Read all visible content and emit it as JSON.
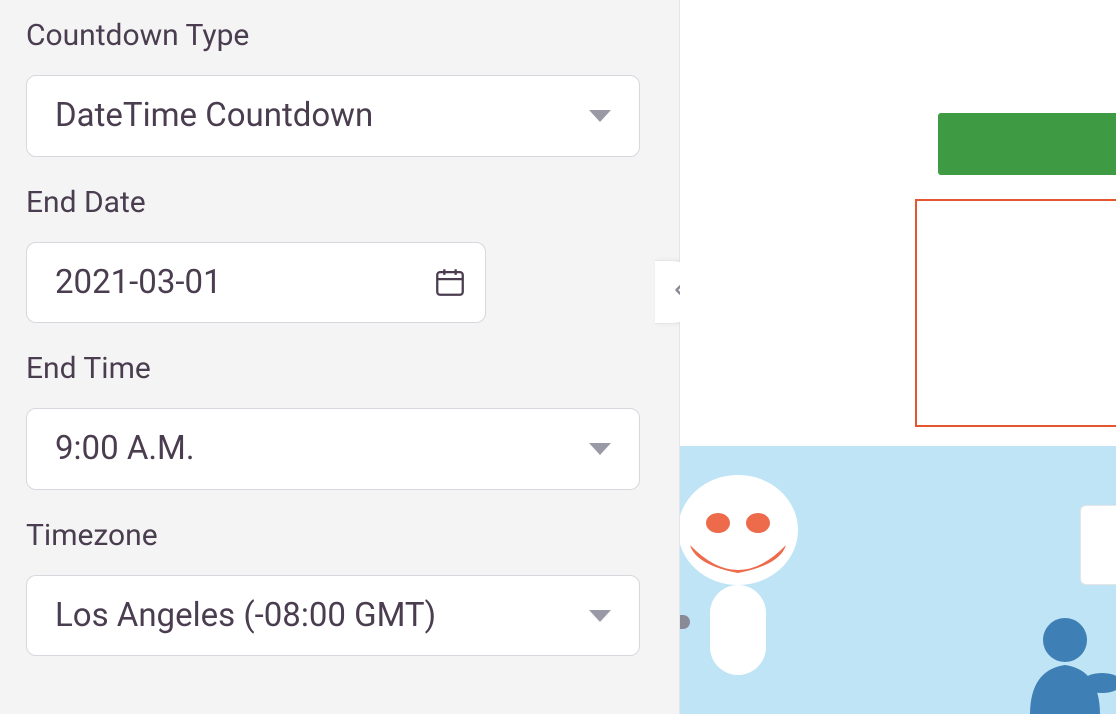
{
  "sidebar": {
    "countdown_type": {
      "label": "Countdown Type",
      "value": "DateTime Countdown"
    },
    "end_date": {
      "label": "End Date",
      "value": "2021-03-01"
    },
    "end_time": {
      "label": "End Time",
      "value": "9:00 A.M."
    },
    "timezone": {
      "label": "Timezone",
      "value": "Los Angeles (-08:00 GMT)"
    }
  },
  "colors": {
    "green_button": "#3e9a43",
    "outline": "#e4572e",
    "sky": "#bfe4f5"
  }
}
